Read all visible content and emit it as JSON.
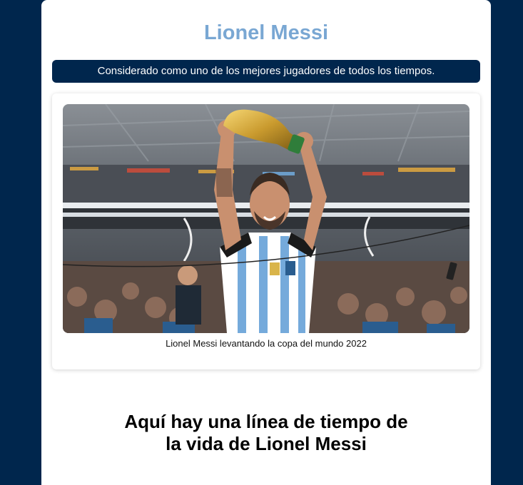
{
  "header": {
    "title": "Lionel Messi",
    "subtitle": "Considerado como uno de los mejores jugadores de todos los tiempos."
  },
  "photo_card": {
    "caption": "Lionel Messi levantando la copa del mundo 2022"
  },
  "timeline": {
    "heading_line1": "Aquí hay una línea de tiempo de",
    "heading_line2": "la vida de Lionel Messi"
  },
  "colors": {
    "background": "#00264d",
    "title": "#79a7d3",
    "banner": "#00264d"
  }
}
